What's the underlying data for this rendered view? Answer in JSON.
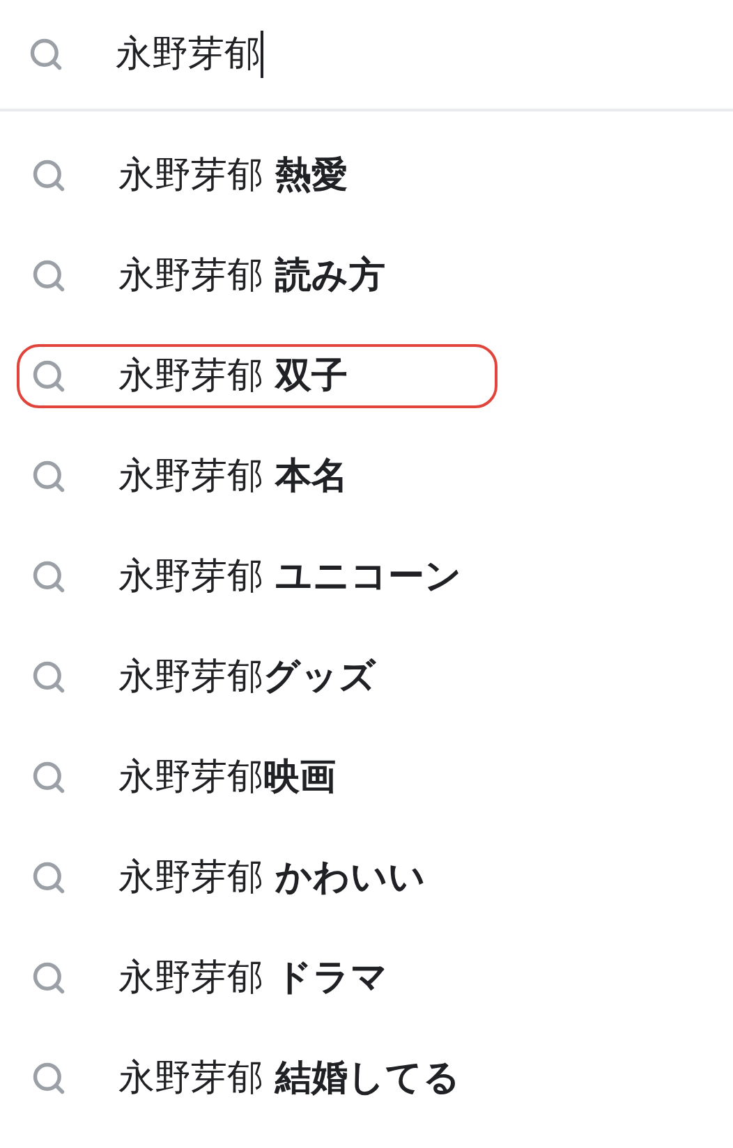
{
  "search": {
    "value": "永野芽郁"
  },
  "suggestions": [
    {
      "text": "永野芽郁 **熱愛**",
      "highlighted": false
    },
    {
      "text": "永野芽郁 **読み方**",
      "highlighted": false
    },
    {
      "text": "永野芽郁 **双子**",
      "highlighted": true
    },
    {
      "text": "永野芽郁 **本名**",
      "highlighted": false
    },
    {
      "text": "永野芽郁 **ユニコーン**",
      "highlighted": false
    },
    {
      "text": "永野芽郁**グッズ**",
      "highlighted": false
    },
    {
      "text": "永野芽郁**映画**",
      "highlighted": false
    },
    {
      "text": "永野芽郁 **かわいい**",
      "highlighted": false
    },
    {
      "text": "永野芽郁 **ドラマ**",
      "highlighted": false
    },
    {
      "text": "永野芽郁 **結婚してる**",
      "highlighted": false
    }
  ]
}
